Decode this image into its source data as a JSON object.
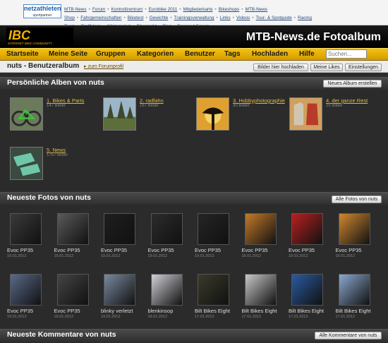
{
  "topbar": {
    "partner_logo": {
      "brand": "netzathleten",
      "tagline": "sportpartner"
    },
    "links": [
      "MTB-News",
      "Forum",
      "Kontrollzentrum",
      "Eurobike 2011",
      "Mitgliederkarte",
      "Bikeshops",
      "MTB-News Shop",
      "Fahrgemeinschaften",
      "Biketest",
      "Gewichte",
      "Trainingsverwaltung",
      "Links",
      "Videos",
      "Tour- & Spotguide",
      "Racing Team",
      "Profiblogs",
      "Winterpokal",
      "Bikemarkt",
      "Blog",
      "Rennrad-Forum"
    ]
  },
  "banner": {
    "logo_text": "IBC",
    "logo_sub": "INTERNET BIKE COMMUNITY",
    "title": "MTB-News.de Fotoalbum"
  },
  "nav": {
    "items": [
      "Startseite",
      "Meine Seite",
      "Gruppen",
      "Kategorien",
      "Benutzer",
      "Tags",
      "Hochladen",
      "Hilfe"
    ],
    "search_placeholder": "Suchen..."
  },
  "subheader": {
    "title": "nuts - Benutzeralbum",
    "forum_link": "zum Forumprofil",
    "buttons": [
      "Bilder hier hochladen",
      "Meine Likes",
      "Einstellungen"
    ]
  },
  "albums_section": {
    "title": "Persönliche Alben von nuts",
    "button": "Neues Album erstellen",
    "albums": [
      {
        "name": "1. Bikes & Parts",
        "count": "147 Bilder",
        "icon": "green-bike-photo"
      },
      {
        "name": "2. radfahn",
        "count": "167 Bilder",
        "icon": "forest-photo"
      },
      {
        "name": "3. Hobbyphotographie",
        "count": "30 Bilder",
        "icon": "tree-silhouette-photo"
      },
      {
        "name": "4. der ganze Rest",
        "count": "25 Bilder",
        "icon": "clothes-photo"
      },
      {
        "name": "5. News",
        "count": "1757 Bilder",
        "icon": "mint-parts-photo"
      }
    ]
  },
  "photos_section": {
    "title": "Neueste Fotos von nuts",
    "button": "Alle Fotos von nuts",
    "photos": [
      {
        "title": "Evoc PP35",
        "date": "19.01.2012",
        "color": "#3a3a3a"
      },
      {
        "title": "Evoc PP35",
        "date": "19.01.2012",
        "color": "#5a5a5a"
      },
      {
        "title": "Evoc PP35",
        "date": "19.01.2012",
        "color": "#1e1e1e"
      },
      {
        "title": "Evoc PP35",
        "date": "19.01.2012",
        "color": "#2c2c2c"
      },
      {
        "title": "Evoc PP35",
        "date": "19.01.2012",
        "color": "#252525"
      },
      {
        "title": "Evoc PP35",
        "date": "19.01.2012",
        "color": "#c47a2a"
      },
      {
        "title": "Evoc PP35",
        "date": "19.01.2012",
        "color": "#b82020"
      },
      {
        "title": "Evoc PP35",
        "date": "19.01.2012",
        "color": "#d08830"
      },
      {
        "title": "Evoc PP35",
        "date": "19.01.2012",
        "color": "#5a6a8a"
      },
      {
        "title": "Evoc PP35",
        "date": "19.01.2012",
        "color": "#444444"
      },
      {
        "title": "blinky verletzt",
        "date": "19.01.2012",
        "color": "#7a8aa0"
      },
      {
        "title": "blenkinsop",
        "date": "19.01.2012",
        "color": "#d0d0d8"
      },
      {
        "title": "Bilt Bikes Eight",
        "date": "17.01.2012",
        "color": "#3a3a2a"
      },
      {
        "title": "Bilt Bikes Eight",
        "date": "17.01.2012",
        "color": "#c8c8c8"
      },
      {
        "title": "Bilt Bikes Eight",
        "date": "17.01.2012",
        "color": "#2a5aa0"
      },
      {
        "title": "Bilt Bikes Eight",
        "date": "17.01.2012",
        "color": "#8aa8d0"
      }
    ]
  },
  "comments_section": {
    "title": "Neueste Kommentare von nuts",
    "button": "Alle Kommentare von nuts"
  }
}
